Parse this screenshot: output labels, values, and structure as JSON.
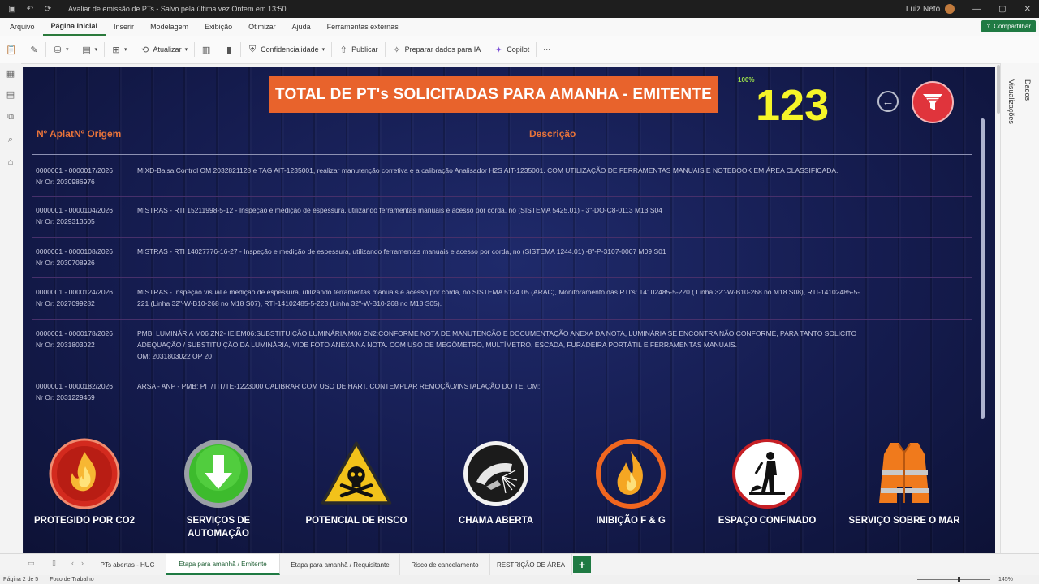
{
  "window": {
    "doc_title": "Avaliar de emissão de PTs - Salvo pela última vez Ontem em 13:50",
    "user": "Luiz Neto"
  },
  "menu": {
    "items": [
      "Arquivo",
      "Página Inicial",
      "Inserir",
      "Modelagem",
      "Exibição",
      "Otimizar",
      "Ajuda",
      "Ferramentas externas"
    ],
    "share": "Compartilhar"
  },
  "toolbar": {
    "update": "Atualizar",
    "confidentiality": "Confidencialidade",
    "publish": "Publicar",
    "prepare": "Preparar dados para IA",
    "copilot": "Copilot",
    "more": "···"
  },
  "panes": {
    "data": "Dados",
    "visualizations": "Visualizações"
  },
  "report": {
    "banner": "TOTAL DE PT's SOLICITADAS PARA AMANHA - EMITENTE",
    "percent": "100%",
    "count": "123",
    "col_origin": "Nº AplatNº Origem",
    "col_desc": "Descrição",
    "rows": [
      {
        "origin": [
          "0000001 - 0000017/2026",
          "Nr Or: 2030986976"
        ],
        "desc": [
          "MIXD-Balsa Control OM 2032821128 e TAG AIT-1235001, realizar manutenção corretiva e a calibração Analisador H2S AIT-1235001. COM UTILIZAÇÃO DE FERRAMENTAS MANUAIS E NOTEBOOK EM ÁREA CLASSIFICADA."
        ]
      },
      {
        "origin": [
          "0000001 - 0000104/2026",
          "Nr Or: 2029313605"
        ],
        "desc": [
          "MISTRAS - RTI 15211998-5-12 - Inspeção e medição de espessura, utilizando ferramentas manuais e acesso por corda, no (SISTEMA 5425.01) - 3\"-DO-C8-0113 M13 S04"
        ]
      },
      {
        "origin": [
          "0000001 - 0000108/2026",
          "Nr Or: 2030708926"
        ],
        "desc": [
          "MISTRAS - RTI 14027776-16-27 - Inspeção e medição de espessura, utilizando ferramentas manuais e acesso por corda, no (SISTEMA 1244.01) -8\"-P-3107-0007 M09 S01"
        ]
      },
      {
        "origin": [
          "0000001 - 0000124/2026",
          "Nr Or: 2027099282"
        ],
        "desc": [
          "MISTRAS - Inspeção visual e medição de espessura, utilizando ferramentas manuais e acesso por corda, no SISTEMA 5124.05 (ARAC), Monitoramento das RTI's: 14102485-5-220 ( Linha 32\"-W-B10-268 no M18 S08), RTI-14102485-5-",
          "221 (Linha 32\"-W-B10-268 no M18 S07), RTI-14102485-5-223 (Linha 32\"-W-B10-268 no M18 S05)."
        ]
      },
      {
        "origin": [
          "0000001 - 0000178/2026",
          "Nr Or: 2031803022"
        ],
        "desc": [
          "PMB: LUMINÁRIA M06 ZN2- IEIEM06:SUBSTITUIÇÃO LUMINÁRIA M06 ZN2:CONFORME NOTA DE MANUTENÇÃO E DOCUMENTAÇÃO ANEXA DA NOTA, LUMINÁRIA SE ENCONTRA NÃO CONFORME, PARA TANTO SOLICITO",
          "ADEQUAÇÃO / SUBSTITUIÇÃO DA LUMINÁRIA, VIDE FOTO ANEXA NA NOTA. COM USO DE MEGÔMETRO, MULTÍMETRO, ESCADA, FURADEIRA PORTÁTIL E FERRAMENTAS MANUAIS.",
          "OM: 2031803022 OP 20"
        ]
      },
      {
        "origin": [
          "0000001 - 0000182/2026",
          "Nr Or: 2031229469"
        ],
        "desc": [
          "ARSA - ANP - PMB: PIT/TIT/TE-1223000 CALIBRAR COM USO DE HART, CONTEMPLAR REMOÇÃO/INSTALAÇÃO DO TE. OM:"
        ]
      }
    ],
    "icons": [
      {
        "name": "co2-fire-icon",
        "label": "PROTEGIDO POR CO2"
      },
      {
        "name": "automation-download-icon",
        "label": "SERVIÇOS DE AUTOMAÇÃO"
      },
      {
        "name": "skull-warning-icon",
        "label": "POTENCIAL DE RISCO"
      },
      {
        "name": "welding-icon",
        "label": "CHAMA ABERTA"
      },
      {
        "name": "flame-inhibition-icon",
        "label": "INIBIÇÃO F & G"
      },
      {
        "name": "confined-space-icon",
        "label": "ESPAÇO CONFINADO"
      },
      {
        "name": "life-vest-icon",
        "label": "SERVIÇO SOBRE O MAR"
      }
    ]
  },
  "tabs": {
    "items": [
      "PTs abertas - HUC",
      "Etapa para amanhã / Emitente",
      "Etapa para amanhã / Requisitante",
      "Risco de cancelamento",
      "RESTRIÇÃO DE ÁREA"
    ],
    "active_index": 1
  },
  "status": {
    "page": "Página 2 de 5",
    "focus": "Foco de Trabalho",
    "zoom": "145%"
  },
  "colors": {
    "banner": "#e8632c",
    "count": "#f5f528",
    "header_text": "#e8733a",
    "canvas": "#151c4f"
  }
}
